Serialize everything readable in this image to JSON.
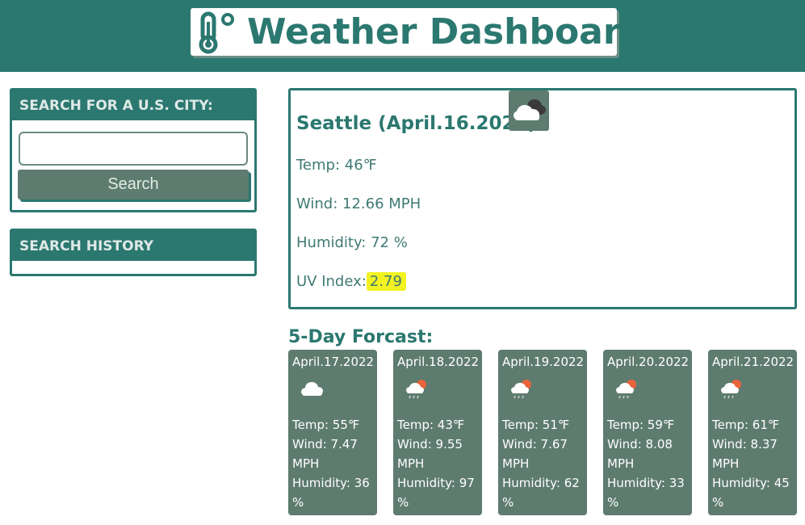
{
  "app": {
    "title": "Weather Dashboard",
    "title_icon": "thermometer-icon"
  },
  "sidebar": {
    "search_heading": "SEARCH FOR A U.S. CITY:",
    "search_input_value": "",
    "search_placeholder": "",
    "search_button_label": "Search",
    "history_heading": "SEARCH HISTORY",
    "history_items": []
  },
  "current": {
    "city_date": "Seattle (April.16.2022)",
    "icon": "cloudy-icon",
    "temp": "Temp: 46℉",
    "wind": "Wind: 12.66 MPH",
    "humidity": "Humidity: 72 %",
    "uv_label": "UV Index:",
    "uv_value": "2.79",
    "uv_color": "#f2f221"
  },
  "forecast": {
    "title": "5-Day Forcast:",
    "days": [
      {
        "date": "April.17.2022",
        "icon": "cloud-icon",
        "temp": "Temp: 55℉",
        "wind1": "Wind: 7.47",
        "wind2": "MPH",
        "hum1": "Humidity: 36",
        "hum2": "%"
      },
      {
        "date": "April.18.2022",
        "icon": "sun-rain-cloud-icon",
        "temp": "Temp: 43℉",
        "wind1": "Wind: 9.55",
        "wind2": "MPH",
        "hum1": "Humidity: 97",
        "hum2": "%"
      },
      {
        "date": "April.19.2022",
        "icon": "sun-rain-cloud-icon",
        "temp": "Temp: 51℉",
        "wind1": "Wind: 7.67",
        "wind2": "MPH",
        "hum1": "Humidity: 62",
        "hum2": "%"
      },
      {
        "date": "April.20.2022",
        "icon": "sun-rain-cloud-icon",
        "temp": "Temp: 59℉",
        "wind1": "Wind: 8.08",
        "wind2": "MPH",
        "hum1": "Humidity: 33",
        "hum2": "%"
      },
      {
        "date": "April.21.2022",
        "icon": "sun-rain-cloud-icon",
        "temp": "Temp: 61℉",
        "wind1": "Wind: 8.37",
        "wind2": "MPH",
        "hum1": "Humidity: 45",
        "hum2": "%"
      }
    ]
  },
  "colors": {
    "header": "#2b7870",
    "card": "#5e7b6f",
    "text": "#2a6e66"
  }
}
